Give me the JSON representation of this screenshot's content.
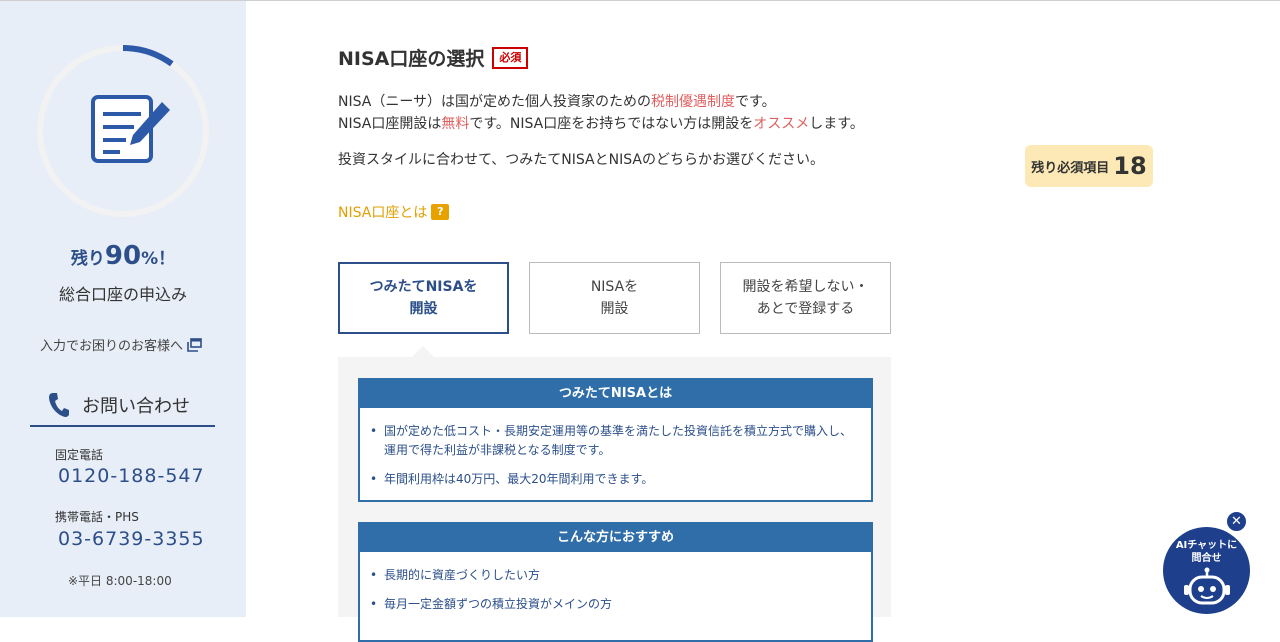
{
  "sidebar": {
    "remaining_prefix": "残り",
    "remaining_percent": "90",
    "remaining_suffix": "%！",
    "progress_done": 0.1,
    "app_title": "総合口座の申込み",
    "help_link": "入力でお困りのお客様へ",
    "contact_title": "お問い合わせ",
    "landline_label": "固定電話",
    "landline_number": "0120-188-547",
    "mobile_label": "携帯電話・PHS",
    "mobile_number": "03-6739-3355",
    "hours": "※平日 8:00-18:00"
  },
  "main": {
    "title": "NISA口座の選択",
    "required_badge": "必須",
    "desc_line1": {
      "a": "NISA（ニーサ）は国が定めた個人投資家のための",
      "b": "税制優遇制度",
      "c": "です。"
    },
    "desc_line2": {
      "a": "NISA口座開設は",
      "b": "無料",
      "c": "です。NISA口座をお持ちではない方は開設を",
      "d": "オススメ",
      "e": "します。"
    },
    "desc_line3": "投資スタイルに合わせて、つみたてNISAとNISAのどちらかお選びください。",
    "nisa_link": "NISA口座とは",
    "help_badge": "?",
    "remaining_required_label": "残り必須項目",
    "remaining_required_count": "18",
    "options": [
      {
        "line1": "つみたてNISAを",
        "line2": "開設",
        "selected": true
      },
      {
        "line1": "NISAを",
        "line2": "開設",
        "selected": false
      },
      {
        "line1": "開設を希望しない・",
        "line2": "あとで登録する",
        "selected": false
      }
    ],
    "box1": {
      "title": "つみたてNISAとは",
      "items": [
        "国が定めた低コスト・長期安定運用等の基準を満たした投資信託を積立方式で購入し、運用で得た利益が非課税となる制度です。",
        "年間利用枠は40万円、最大20年間利用できます。"
      ]
    },
    "box2": {
      "title": "こんな方におすすめ",
      "items": [
        "長期的に資産づくりしたい方",
        "毎月一定金額ずつの積立投資がメインの方"
      ]
    }
  },
  "chat": {
    "line1": "AIチャットに",
    "line2": "問合せ",
    "close": "✕"
  },
  "colors": {
    "primary": "#2c4f8a",
    "box_header": "#2f6ea9",
    "highlight": "#e06060",
    "link": "#e0a000",
    "sidebar_bg": "#e8eef7",
    "chat_bg": "#1e3f8c"
  }
}
